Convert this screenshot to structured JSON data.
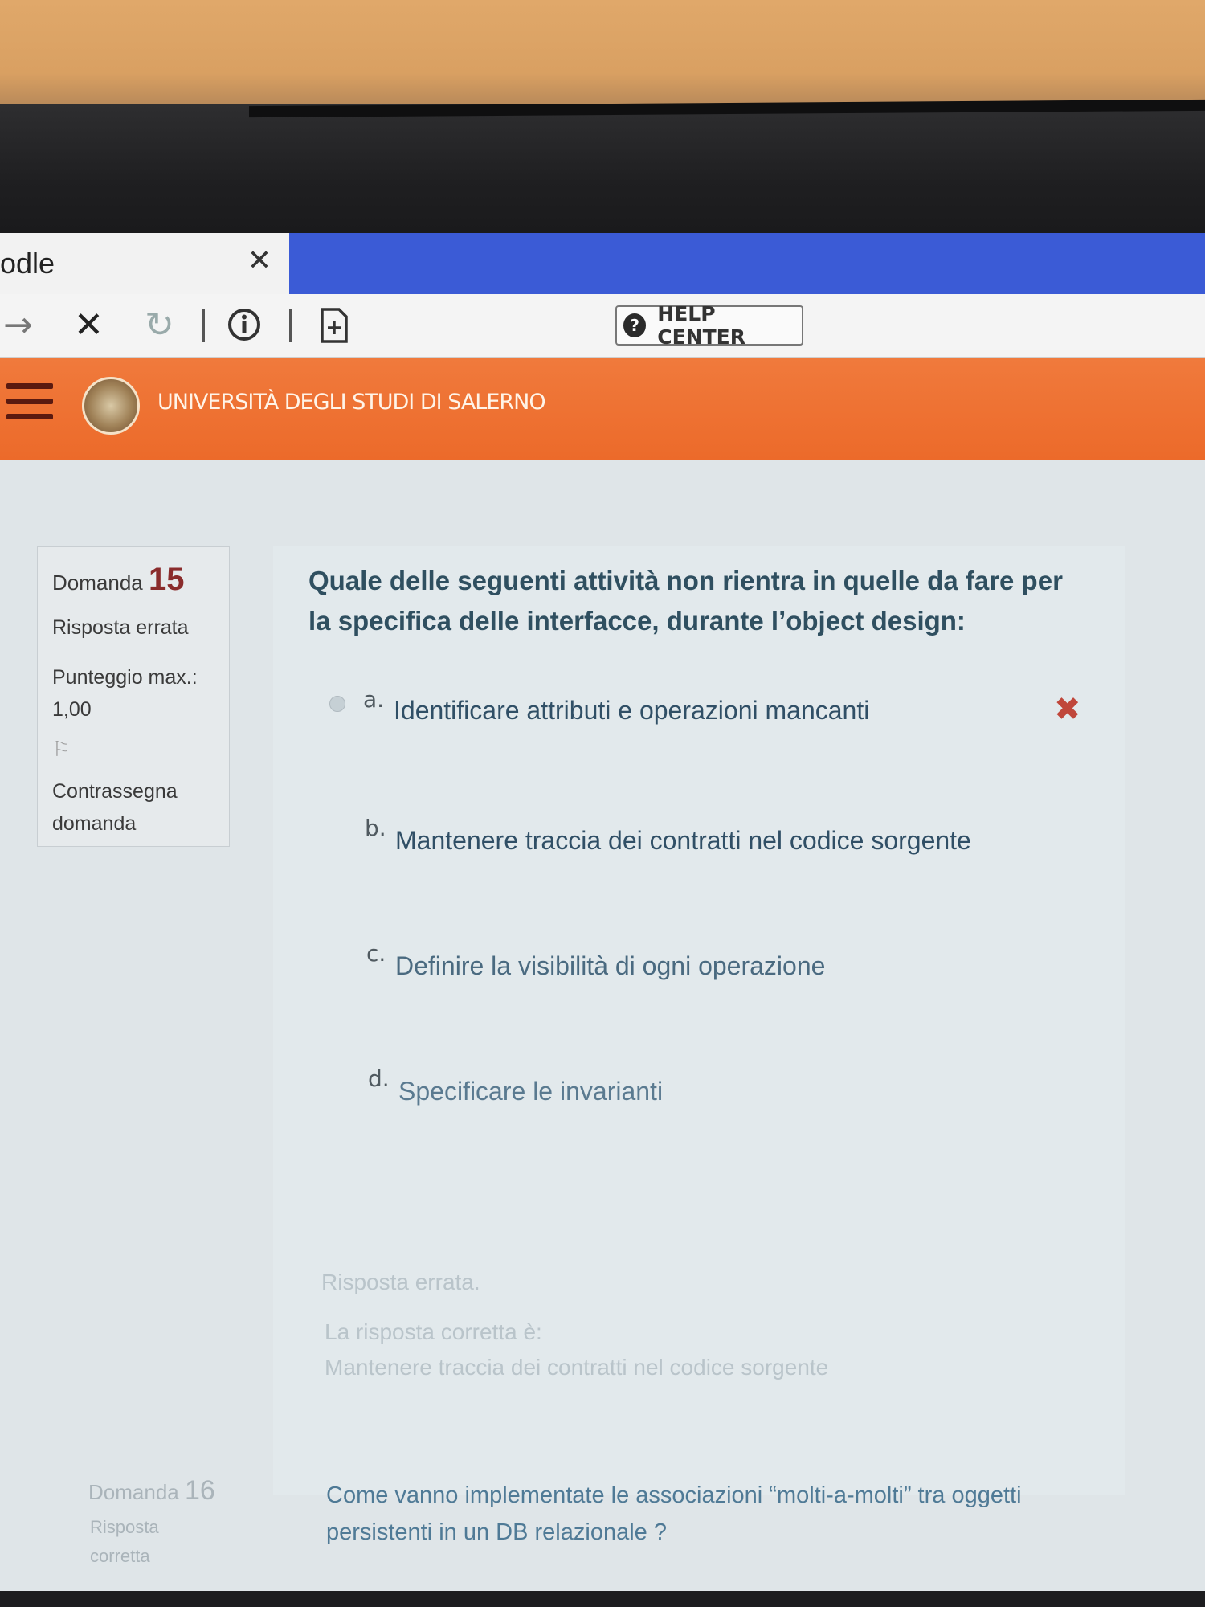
{
  "browser": {
    "tab_title": "odle",
    "tab_close_icon": "close-icon",
    "help_center_label": "HELP CENTER"
  },
  "site": {
    "name": "UNIVERSITÀ DEGLI STUDI DI SALERNO"
  },
  "question_info": {
    "label": "Domanda",
    "number": "15",
    "status": "Risposta errata",
    "max_score_label": "Punteggio max.:",
    "max_score_value": "1,00",
    "flag_label_1": "Contrassegna",
    "flag_label_2": "domanda"
  },
  "question": {
    "text": "Quale delle seguenti attività non rientra in quelle da fare per la specifica delle interfacce, durante l’object design:",
    "options": [
      {
        "letter": "a.",
        "text": "Identificare attributi e operazioni mancanti",
        "selected": true,
        "marked_wrong": true
      },
      {
        "letter": "b.",
        "text": "Mantenere traccia dei contratti nel codice sorgente"
      },
      {
        "letter": "c.",
        "text": "Definire la visibilità di ogni operazione"
      },
      {
        "letter": "d.",
        "text": "Specificare le invarianti"
      }
    ],
    "wrong_icon": "cross-icon",
    "feedback_title": "Risposta errata.",
    "feedback_correct_label": "La risposta corretta è:",
    "feedback_correct_answer": "Mantenere traccia dei contratti nel codice sorgente"
  },
  "next_question": {
    "label": "Domanda",
    "number": "16",
    "status_1": "Risposta",
    "status_2": "corretta",
    "text": "Come vanno implementate le associazioni “molti-a-molti” tra oggetti persistenti in un DB relazionale ?"
  },
  "colors": {
    "header_orange": "#ec6a2a",
    "tab_blue": "#3b5bd6",
    "question_number": "#8a2c2c",
    "wrong_mark": "#c0473b"
  }
}
